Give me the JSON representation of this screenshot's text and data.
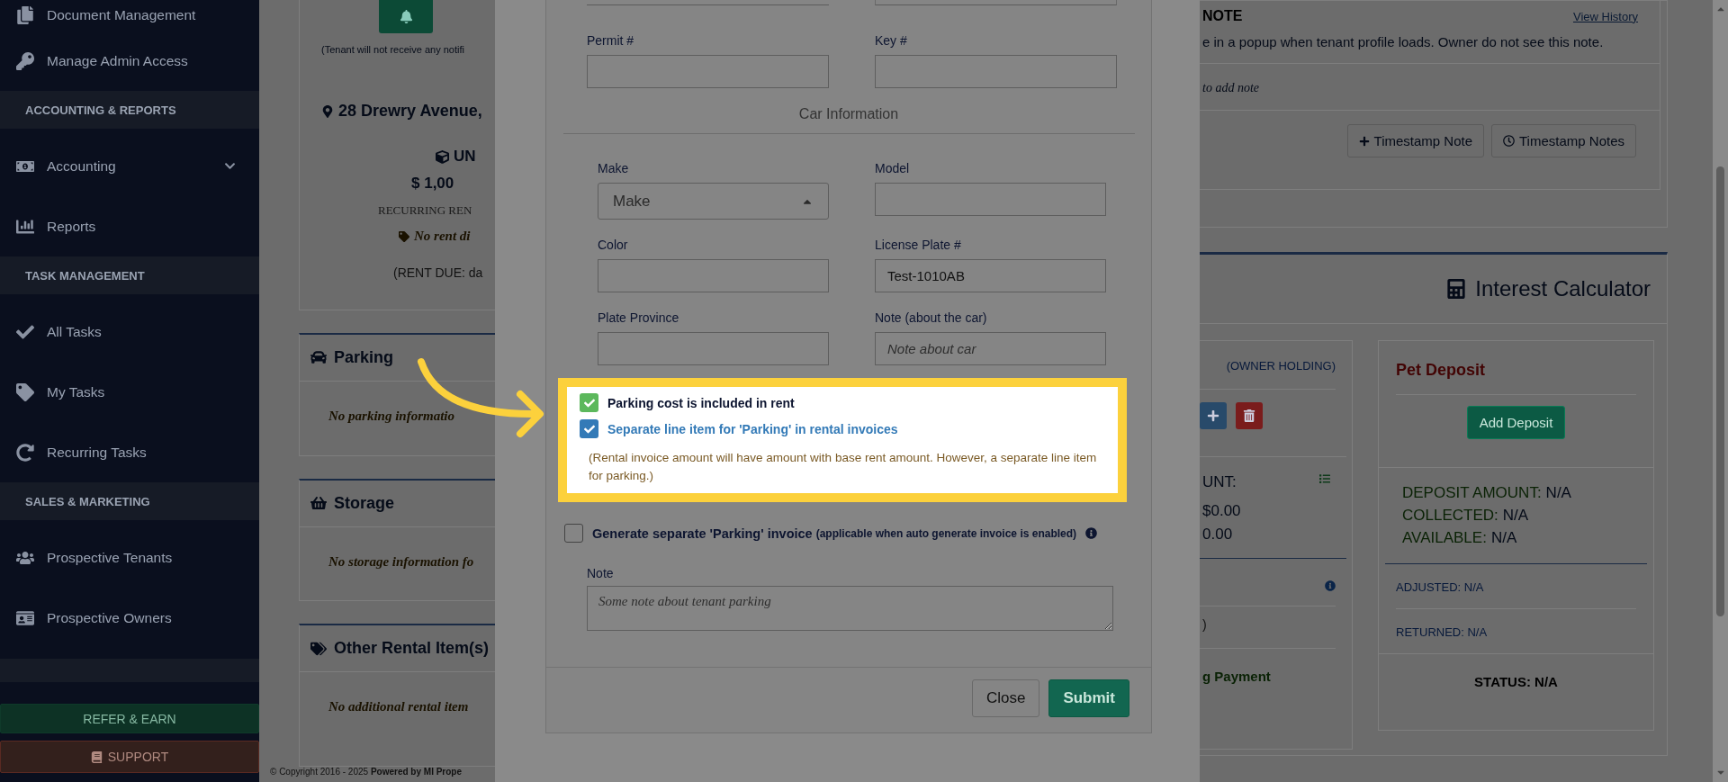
{
  "sidebar": {
    "items": [
      {
        "kind": "item",
        "label": "Document Management",
        "expandable": false
      },
      {
        "kind": "item",
        "label": "Manage Admin Access",
        "expandable": false
      },
      {
        "kind": "header",
        "label": "ACCOUNTING & REPORTS"
      },
      {
        "kind": "item",
        "label": "Accounting",
        "expandable": true
      },
      {
        "kind": "item",
        "label": "Reports",
        "expandable": false
      },
      {
        "kind": "header",
        "label": "TASK MANAGEMENT"
      },
      {
        "kind": "item",
        "label": "All Tasks",
        "expandable": false
      },
      {
        "kind": "item",
        "label": "My Tasks",
        "expandable": false
      },
      {
        "kind": "item",
        "label": "Recurring Tasks",
        "expandable": false
      },
      {
        "kind": "header",
        "label": "SALES & MARKETING"
      },
      {
        "kind": "item",
        "label": "Prospective Tenants",
        "expandable": false
      },
      {
        "kind": "item",
        "label": "Prospective Owners",
        "expandable": false
      }
    ],
    "buttons": [
      {
        "kind": "refer",
        "label": "REFER & EARN"
      },
      {
        "kind": "support",
        "label": "SUPPORT"
      }
    ]
  },
  "tenant_summary": {
    "notice": "(Tenant will not receive any notifi",
    "address": "28 Drewry Avenue,",
    "unit": "UN",
    "rent": "$ 1,00",
    "rent_label": "RECURRING REN",
    "discount": "No rent di",
    "rent_due": "(RENT DUE: da"
  },
  "side_cards": [
    {
      "title": "Parking",
      "message": "No parking informatio"
    },
    {
      "title": "Storage",
      "message": "No storage information fo"
    },
    {
      "title": "Other Rental Item(s)",
      "message": "No additional rental item"
    }
  ],
  "footer": {
    "copyright": "© Copyright 2016 - 2025",
    "powered": "Powered by MI Prope"
  },
  "modal": {
    "top_fields": [
      {
        "label": "Permit #"
      },
      {
        "label": "Key #"
      }
    ],
    "section_title": "Car Information",
    "car_fields": [
      {
        "kind": "select",
        "label": "Make",
        "placeholder": "Make"
      },
      {
        "kind": "input",
        "label": "Model"
      },
      {
        "kind": "input",
        "label": "Color"
      },
      {
        "kind": "input",
        "label": "License Plate #",
        "value": "Test-1010AB"
      },
      {
        "kind": "input",
        "label": "Plate Province"
      },
      {
        "kind": "input",
        "label": "Note (about the car)",
        "placeholder": "Note about car"
      }
    ],
    "highlighted_options": [
      {
        "label": "Parking cost is included in rent",
        "checked": true,
        "color": "#5cb85c"
      },
      {
        "label": "Separate line item for 'Parking' in rental invoices",
        "checked": true,
        "color": "#337ab7"
      }
    ],
    "help_text": "(Rental invoice amount will have amount with base rent amount. However, a separate line item for parking.)",
    "invoice_option": {
      "label": "Generate separate 'Parking' invoice",
      "note": "(applicable when auto generate invoice is enabled)",
      "checked": false
    },
    "note_field": {
      "label": "Note",
      "placeholder": "Some note about tenant parking"
    },
    "buttons": [
      {
        "kind": "secondary",
        "label": "Close"
      },
      {
        "kind": "primary",
        "label": "Submit"
      }
    ]
  },
  "note_card": {
    "title": "NOTE",
    "history_link": "View History",
    "description": "e in a popup when tenant profile loads. Owner do not see this note.",
    "prompt": "to add note",
    "buttons": [
      {
        "kind": "add",
        "label": "Timestamp Note"
      },
      {
        "kind": "history",
        "label": "Timestamp Notes"
      }
    ]
  },
  "interest_card": {
    "title": "Interest Calculator",
    "holding": {
      "tag": "(OWNER HOLDING)",
      "amount_label": "UNT:",
      "amounts": [
        "$0.00",
        "0.00"
      ],
      "closing": ")",
      "payment": "g Payment"
    },
    "pet_deposit": {
      "title": "Pet Deposit",
      "add_button": "Add Deposit",
      "stats": [
        {
          "label": "DEPOSIT AMOUNT:",
          "value": "N/A"
        },
        {
          "label": "COLLECTED:",
          "value": "N/A"
        },
        {
          "label": "AVAILABLE:",
          "value": "N/A"
        }
      ],
      "details": [
        {
          "label": "ADJUSTED:",
          "value": "N/A"
        },
        {
          "label": "RETURNED:",
          "value": "N/A"
        }
      ],
      "status": "STATUS: N/A"
    }
  }
}
